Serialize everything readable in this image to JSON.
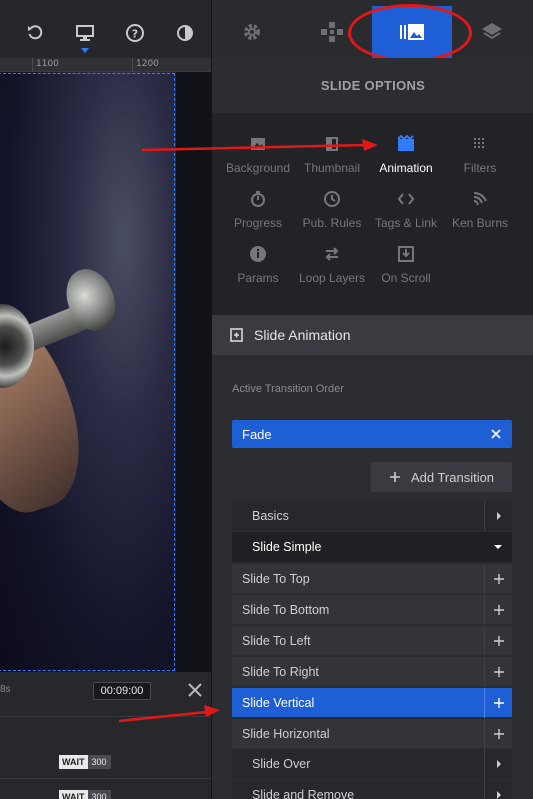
{
  "ruler": {
    "labels": [
      "1100",
      "1200"
    ]
  },
  "timeline": {
    "seconds_label": "8s",
    "current_time": "00:09:00",
    "wait_rows": [
      {
        "tag": "WAIT",
        "value": "300"
      },
      {
        "tag": "WAIT",
        "value": "300"
      }
    ]
  },
  "top_tabs": [
    "settings",
    "navigation",
    "slide-options",
    "layers"
  ],
  "panel": {
    "title": "SLIDE OPTIONS",
    "options": [
      {
        "label": "Background",
        "icon": "image-icon",
        "active": false
      },
      {
        "label": "Thumbnail",
        "icon": "thumbnail-icon",
        "active": false
      },
      {
        "label": "Animation",
        "icon": "film-icon",
        "active": true
      },
      {
        "label": "Filters",
        "icon": "filters-icon",
        "active": false
      },
      {
        "label": "Progress",
        "icon": "stopwatch-icon",
        "active": false
      },
      {
        "label": "Pub. Rules",
        "icon": "clock-icon",
        "active": false
      },
      {
        "label": "Tags & Link",
        "icon": "code-icon",
        "active": false
      },
      {
        "label": "Ken Burns",
        "icon": "ken-burns-icon",
        "active": false
      },
      {
        "label": "Params",
        "icon": "info-icon",
        "active": false
      },
      {
        "label": "Loop Layers",
        "icon": "loop-icon",
        "active": false
      },
      {
        "label": "On Scroll",
        "icon": "download-icon",
        "active": false
      }
    ]
  },
  "slide_animation": {
    "title": "Slide Animation",
    "active_order_label": "Active Transition Order",
    "active_transitions": [
      "Fade"
    ],
    "add_transition_label": "Add Transition",
    "categories": [
      {
        "label": "Basics",
        "expanded": false
      },
      {
        "label": "Slide Simple",
        "expanded": true
      }
    ],
    "items": [
      "Slide To Top",
      "Slide To Bottom",
      "Slide To Left",
      "Slide To Right",
      "Slide Vertical",
      "Slide Horizontal"
    ],
    "selected_item": "Slide Vertical",
    "more_categories": [
      "Slide Over",
      "Slide and Remove"
    ]
  },
  "colors": {
    "accent": "#1f5fd6",
    "annotation": "#e21818"
  }
}
